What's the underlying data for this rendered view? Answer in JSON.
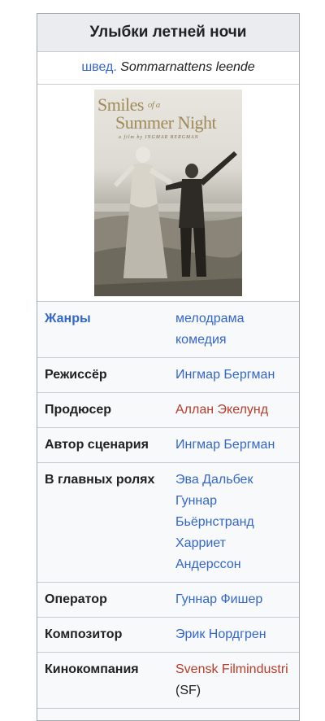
{
  "infobox": {
    "title": "Улыбки летней ночи",
    "original": {
      "lang": "швед.",
      "title": "Sommarnattens leende"
    },
    "poster": {
      "title_line1": "Smiles",
      "title_of": "of a",
      "title_line2": "Summer Night",
      "subtitle": "a film by INGMAR BERGMAN"
    },
    "rows": {
      "genres": {
        "label": "Жанры",
        "values": [
          "мелодрама",
          "комедия"
        ]
      },
      "director": {
        "label": "Режиссёр",
        "value": "Ингмар Бергман"
      },
      "producer": {
        "label": "Продюсер",
        "value": "Аллан Экелунд"
      },
      "writer": {
        "label": "Автор сценария",
        "value": "Ингмар Бергман"
      },
      "starring": {
        "label": "В главных ролях",
        "values": [
          "Эва Дальбек",
          "Гуннар Бьёрнстранд",
          "Харриет Андерссон"
        ]
      },
      "cinematographer": {
        "label": "Оператор",
        "value": "Гуннар Фишер"
      },
      "composer": {
        "label": "Композитор",
        "value": "Эрик Нордгрен"
      },
      "studio": {
        "label": "Кинокомпания",
        "value": "Svensk Filmindustri",
        "suffix": " (SF)"
      }
    },
    "colors": {
      "link": "#3366cc",
      "redlink": "#ba3b2a",
      "header_bg": "#eaecf0",
      "box_bg": "#f8f9fa",
      "border": "#a2a9b1"
    }
  }
}
